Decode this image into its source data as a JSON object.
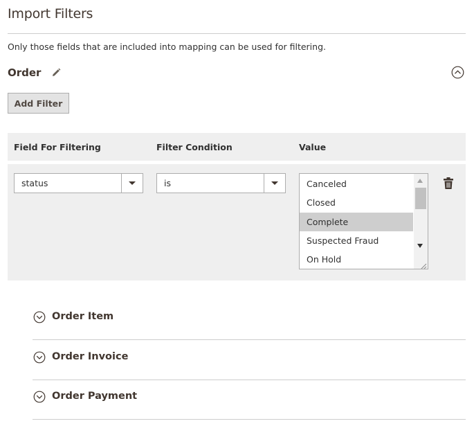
{
  "page": {
    "title": "Import Filters",
    "note": "Only those fields that are included into mapping can be used for filtering."
  },
  "section": {
    "title": "Order",
    "add_filter_label": "Add Filter"
  },
  "grid": {
    "headers": {
      "field": "Field For Filtering",
      "condition": "Filter Condition",
      "value": "Value"
    },
    "row": {
      "field_value": "status",
      "condition_value": "is",
      "value_options": [
        "Canceled",
        "Closed",
        "Complete",
        "Suspected Fraud",
        "On Hold"
      ],
      "selected_option": "Complete"
    }
  },
  "sub_sections": [
    {
      "label": "Order Item"
    },
    {
      "label": "Order Invoice"
    },
    {
      "label": "Order Payment"
    }
  ],
  "icons": {
    "edit": "pencil-icon",
    "collapse": "circle-chevron-up-icon",
    "delete": "trash-icon",
    "expand": "circle-chevron-down-icon"
  },
  "colors": {
    "panel_bg": "#efefef",
    "selected_option_bg": "#cecece",
    "button_bg": "#e3e3e3",
    "text_dark": "#41362f"
  }
}
